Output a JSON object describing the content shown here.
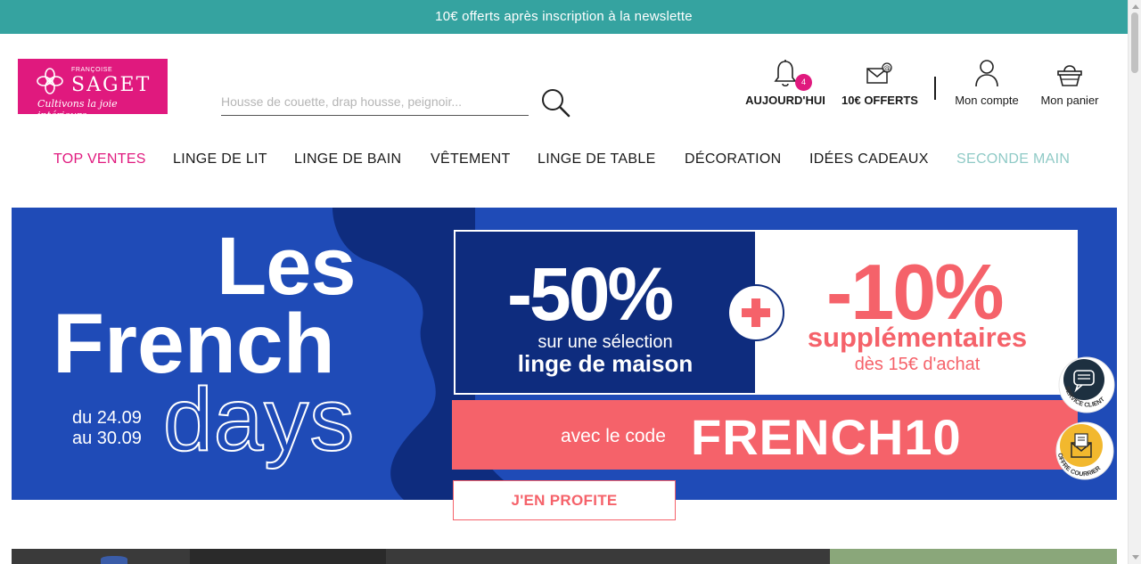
{
  "promo_bar": {
    "text": "10€ offerts après inscription à la newslette"
  },
  "logo": {
    "small": "FRANÇOISE",
    "big": "SAGET",
    "tagline": "Cultivons la joie intérieure"
  },
  "search": {
    "placeholder": "Housse de couette, drap housse, peignoir...",
    "value": ""
  },
  "header": {
    "today": {
      "label": "AUJOURD'HUI",
      "badge": "4"
    },
    "offer": {
      "label": "10€ OFFERTS"
    },
    "account": {
      "label": "Mon compte"
    },
    "cart": {
      "label": "Mon panier"
    }
  },
  "nav": {
    "items": [
      {
        "label": "TOP VENTES",
        "color": "#e0197e"
      },
      {
        "label": "LINGE DE LIT",
        "color": "#1a1a1a"
      },
      {
        "label": "LINGE DE BAIN",
        "color": "#1a1a1a"
      },
      {
        "label": "VÊTEMENT",
        "color": "#1a1a1a"
      },
      {
        "label": "LINGE DE TABLE",
        "color": "#1a1a1a"
      },
      {
        "label": "DÉCORATION",
        "color": "#1a1a1a"
      },
      {
        "label": "IDÉES CADEAUX",
        "color": "#1a1a1a"
      },
      {
        "label": "SECONDE MAIN",
        "color": "#8fcac6"
      }
    ]
  },
  "hero": {
    "les": "Les",
    "french": "French",
    "days": "days",
    "date_from": "du 24.09",
    "date_to": "au 30.09",
    "off50": {
      "big": "-50%",
      "line1": "sur une sélection",
      "line2": "linge de maison"
    },
    "off10": {
      "big": "-10%",
      "line1": "supplémentaires",
      "line2": "dès 15€ d'achat"
    },
    "code_label": "avec le code",
    "code_value": "FRENCH10",
    "cta": "J'EN PROFITE"
  },
  "floating": {
    "service": "SERVICE CLIENT",
    "mail": "OFFRE COURRIER"
  },
  "colors": {
    "brand_pink": "#e0197e",
    "teal": "#35a3a0",
    "hero_blue": "#1f4bb7",
    "navy": "#0e2c7e",
    "coral": "#f5626a"
  }
}
